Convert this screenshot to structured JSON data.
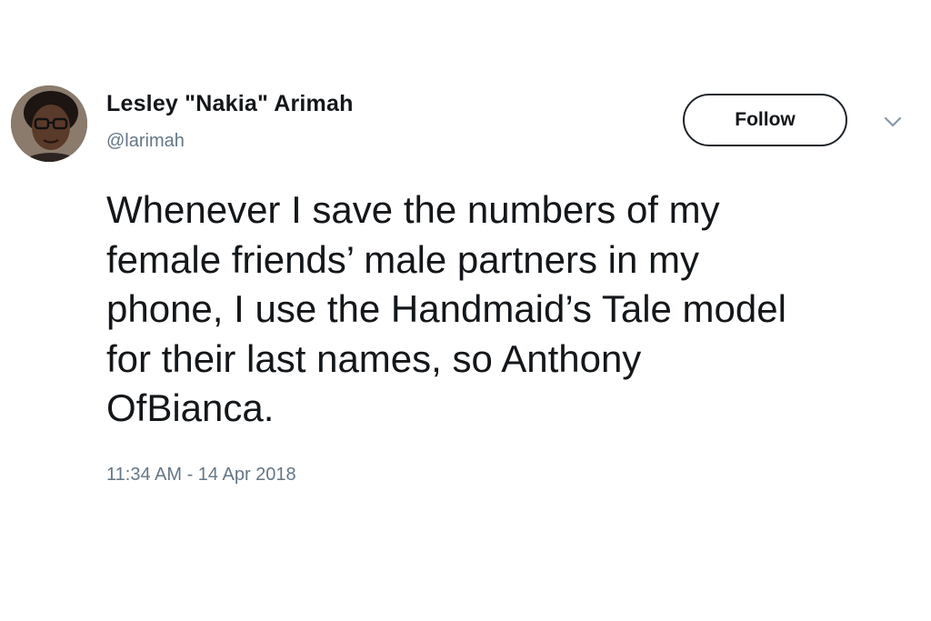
{
  "author": {
    "name": "Lesley \"Nakia\" Arimah",
    "handle": "@larimah"
  },
  "actions": {
    "follow_label": "Follow",
    "menu_icon": "chevron-down-icon"
  },
  "tweet": {
    "text": "Whenever I save the numbers of my\nfemale friends’ male partners in my\nphone, I use the Handmaid’s Tale model\nfor their last names, so Anthony\nOfBianca.",
    "timestamp": "11:34 AM - 14 Apr 2018"
  },
  "colors": {
    "text": "#14171a",
    "secondary_text": "#657786",
    "background": "#ffffff"
  }
}
